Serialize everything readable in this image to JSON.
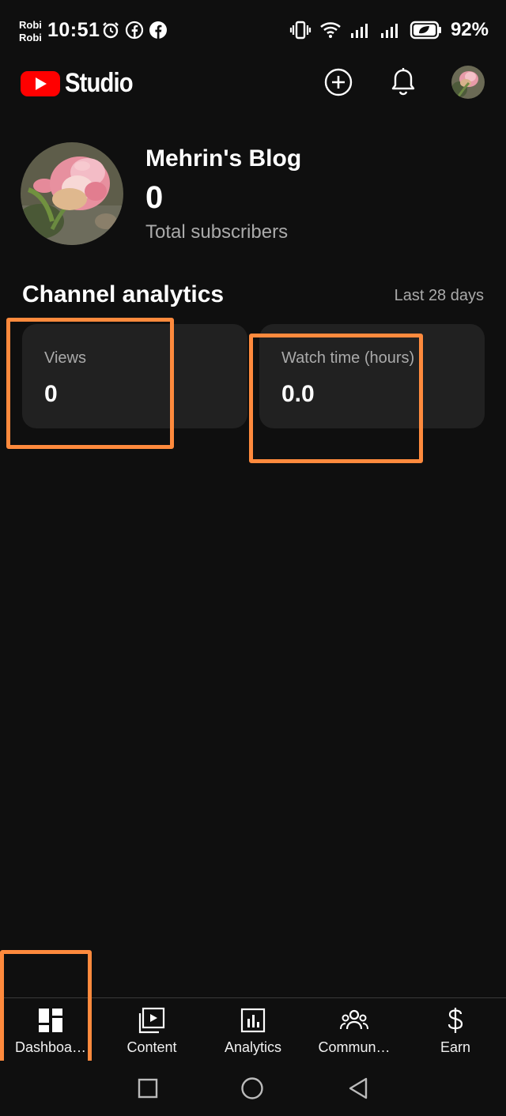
{
  "status_bar": {
    "carrier_line1": "Robi",
    "carrier_line2": "Robi",
    "time": "10:51",
    "battery_percent": "92%",
    "left_icons": [
      "alarm-icon",
      "facebook-outline-icon",
      "facebook-icon"
    ],
    "right_icons": [
      "vibrate-icon",
      "wifi-icon",
      "signal-icon",
      "signal-icon",
      "battery-saver-icon"
    ]
  },
  "header": {
    "app_name": "Studio",
    "brand_color": "#ff0000",
    "actions": [
      "create-icon",
      "notifications-icon",
      "account-avatar"
    ]
  },
  "channel": {
    "name": "Mehrin's Blog",
    "subscriber_count": "0",
    "subscriber_label": "Total subscribers"
  },
  "analytics": {
    "title": "Channel analytics",
    "range": "Last 28 days",
    "cards": [
      {
        "label": "Views",
        "value": "0"
      },
      {
        "label": "Watch time (hours)",
        "value": "0.0"
      }
    ]
  },
  "bottom_nav": {
    "items": [
      {
        "label": "Dashboa…",
        "icon": "dashboard-icon"
      },
      {
        "label": "Content",
        "icon": "content-icon"
      },
      {
        "label": "Analytics",
        "icon": "analytics-icon"
      },
      {
        "label": "Commun…",
        "icon": "community-icon"
      },
      {
        "label": "Earn",
        "icon": "earn-icon"
      }
    ]
  },
  "annotation_color": "#ff8a3d"
}
